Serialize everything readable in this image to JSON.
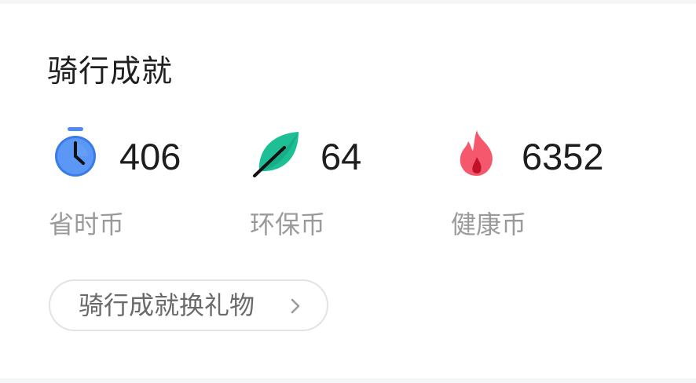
{
  "section": {
    "title": "骑行成就"
  },
  "stats": [
    {
      "icon": "stopwatch-icon",
      "value": "406",
      "label": "省时币",
      "color": "#4f8df2"
    },
    {
      "icon": "leaf-icon",
      "value": "64",
      "label": "环保币",
      "color": "#1fbf96"
    },
    {
      "icon": "flame-icon",
      "value": "6352",
      "label": "健康币",
      "color": "#f5576c"
    }
  ],
  "redeem": {
    "label": "骑行成就换礼物",
    "icon": "chevron-right-icon"
  }
}
